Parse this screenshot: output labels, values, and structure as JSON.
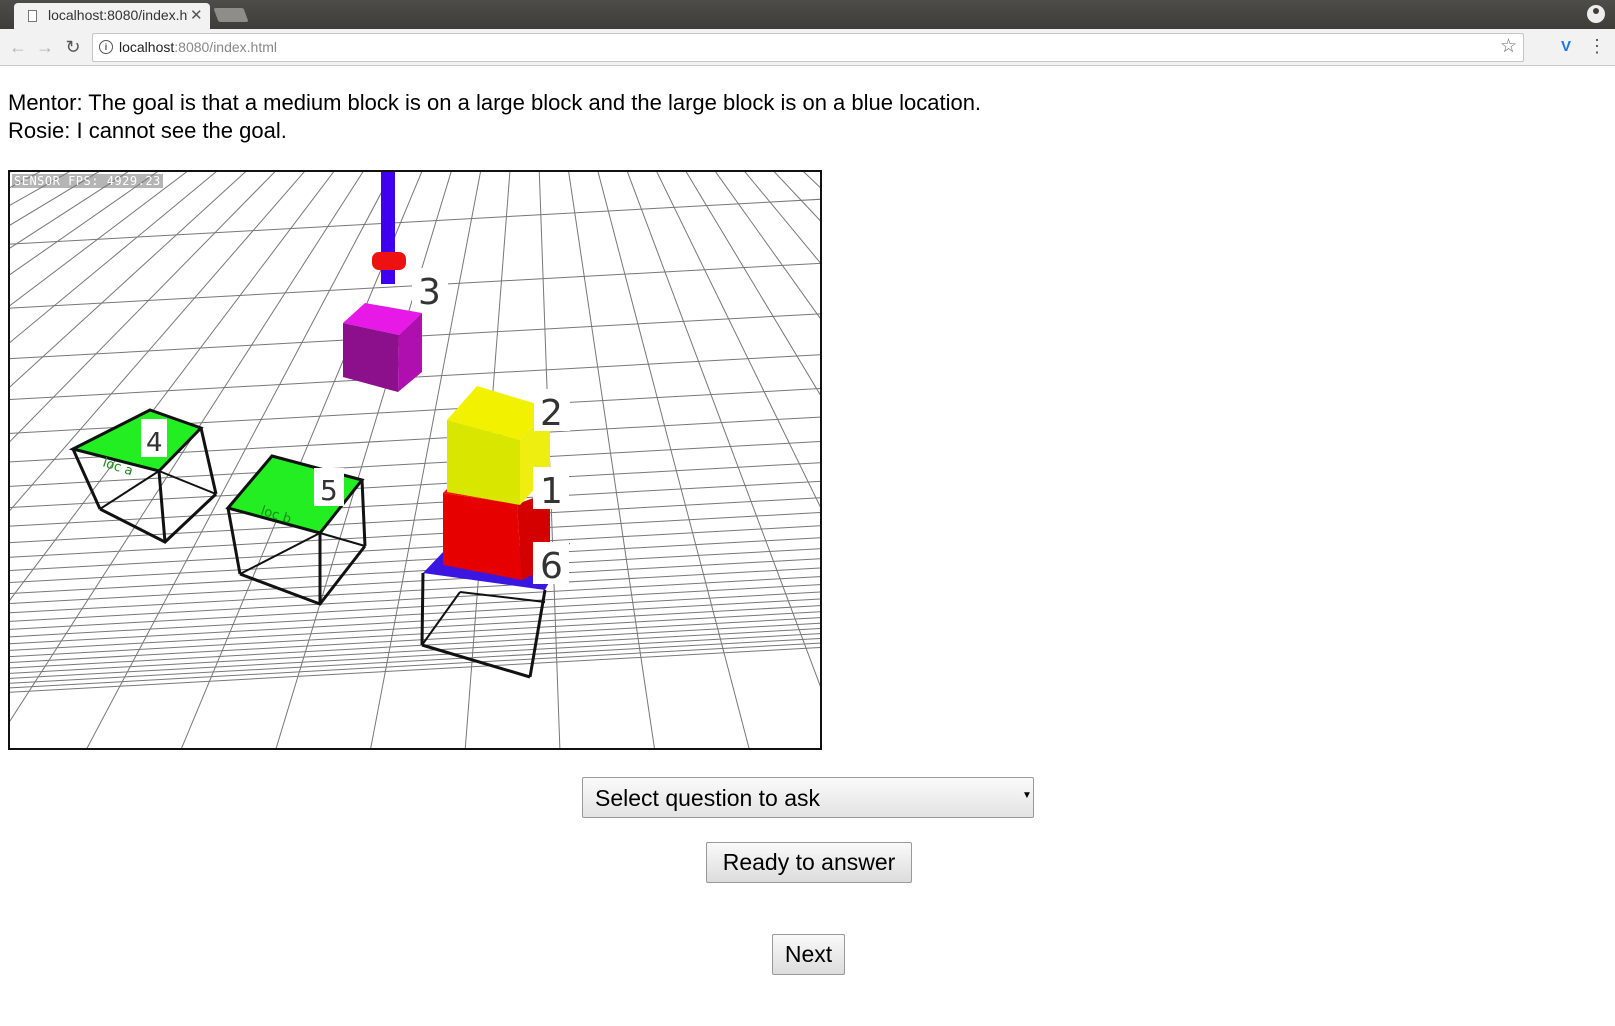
{
  "browser": {
    "tab_title": "localhost:8080/index.html",
    "url_host": "localhost",
    "url_rest": ":8080/index.html"
  },
  "dialog": {
    "mentor": "Mentor: The goal is that a medium block is on a large block and the large block is on a blue location.",
    "rosie": "Rosie: I cannot see the goal."
  },
  "scene": {
    "fps_label": "SENSOR FPS: 4929.23",
    "labels": {
      "block_1": "1",
      "block_2": "2",
      "block_3": "3",
      "location_4": "4",
      "location_5": "5",
      "location_6": "6"
    },
    "location_text": {
      "location_4": "loc a",
      "location_5": "loc b"
    },
    "colors": {
      "arm": "#3e00ee",
      "gripper": "#ee1111",
      "block_3_top": "#e619e6",
      "block_3_front": "#8c0f8c",
      "block_2": "#d9e600",
      "block_1": "#e60000",
      "location_green": "#22ee22",
      "location_blue": "#3b16e0"
    }
  },
  "controls": {
    "question_select": {
      "selected": "Select question to ask"
    },
    "ready_label": "Ready to answer",
    "next_label": "Next"
  }
}
